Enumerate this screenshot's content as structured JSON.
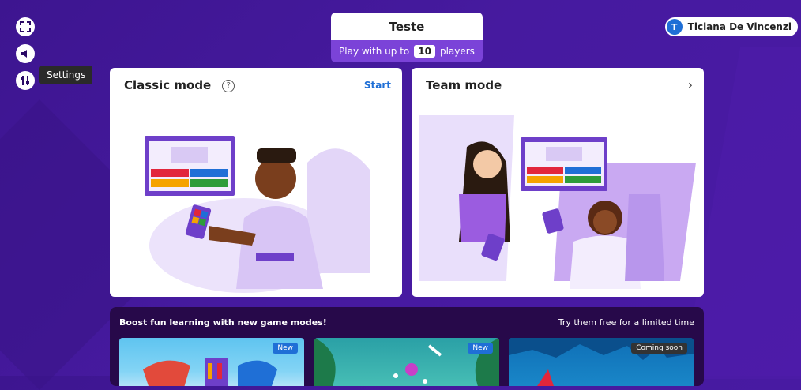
{
  "header": {
    "title": "Teste",
    "players_prefix": "Play with up to",
    "players_count": "10",
    "players_suffix": "players"
  },
  "left_controls": {
    "settings_tooltip": "Settings"
  },
  "user": {
    "initial": "T",
    "name": "Ticiana De Vincenzi"
  },
  "cards": {
    "classic": {
      "title": "Classic mode",
      "action": "Start"
    },
    "team": {
      "title": "Team mode"
    }
  },
  "boost": {
    "title": "Boost fun learning with new game modes!",
    "subtitle": "Try them free for a limited time",
    "items": [
      {
        "badge": "New"
      },
      {
        "badge": "New"
      },
      {
        "badge": "Coming soon"
      }
    ]
  },
  "colors": {
    "background": "#461a9f",
    "accent_blue": "#1f6fd6",
    "title_strip": "#7b43d8",
    "boost_panel": "#27094a"
  }
}
